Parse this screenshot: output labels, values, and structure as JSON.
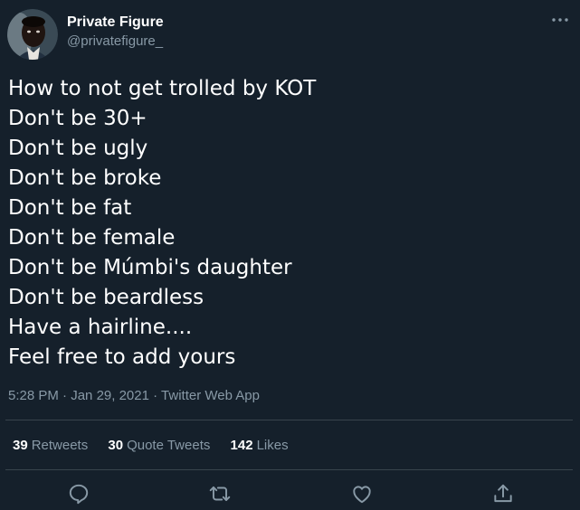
{
  "author": {
    "display_name": "Private Figure",
    "handle": "@privatefigure_"
  },
  "tweet": {
    "lines": [
      "How to not get trolled by KOT",
      "Don't be 30+",
      "Don't be ugly",
      "Don't be broke",
      "Don't be fat",
      "Don't be female",
      "Don't be Múmbi's daughter",
      "Don't be beardless",
      "Have a hairline....",
      "Feel free to add yours"
    ],
    "time": "5:28 PM",
    "separator": "·",
    "date": "Jan 29, 2021",
    "source": "Twitter Web App"
  },
  "stats": {
    "retweets_count": "39",
    "retweets_label": "Retweets",
    "quotes_count": "30",
    "quotes_label": "Quote Tweets",
    "likes_count": "142",
    "likes_label": "Likes"
  },
  "icons": {
    "more": "more-horizontal-icon",
    "reply": "reply-icon",
    "retweet": "retweet-icon",
    "like": "heart-icon",
    "share": "share-icon"
  },
  "colors": {
    "background": "#15202b",
    "primary_text": "#ffffff",
    "secondary_text": "#8899a6",
    "divider": "#38444d"
  }
}
